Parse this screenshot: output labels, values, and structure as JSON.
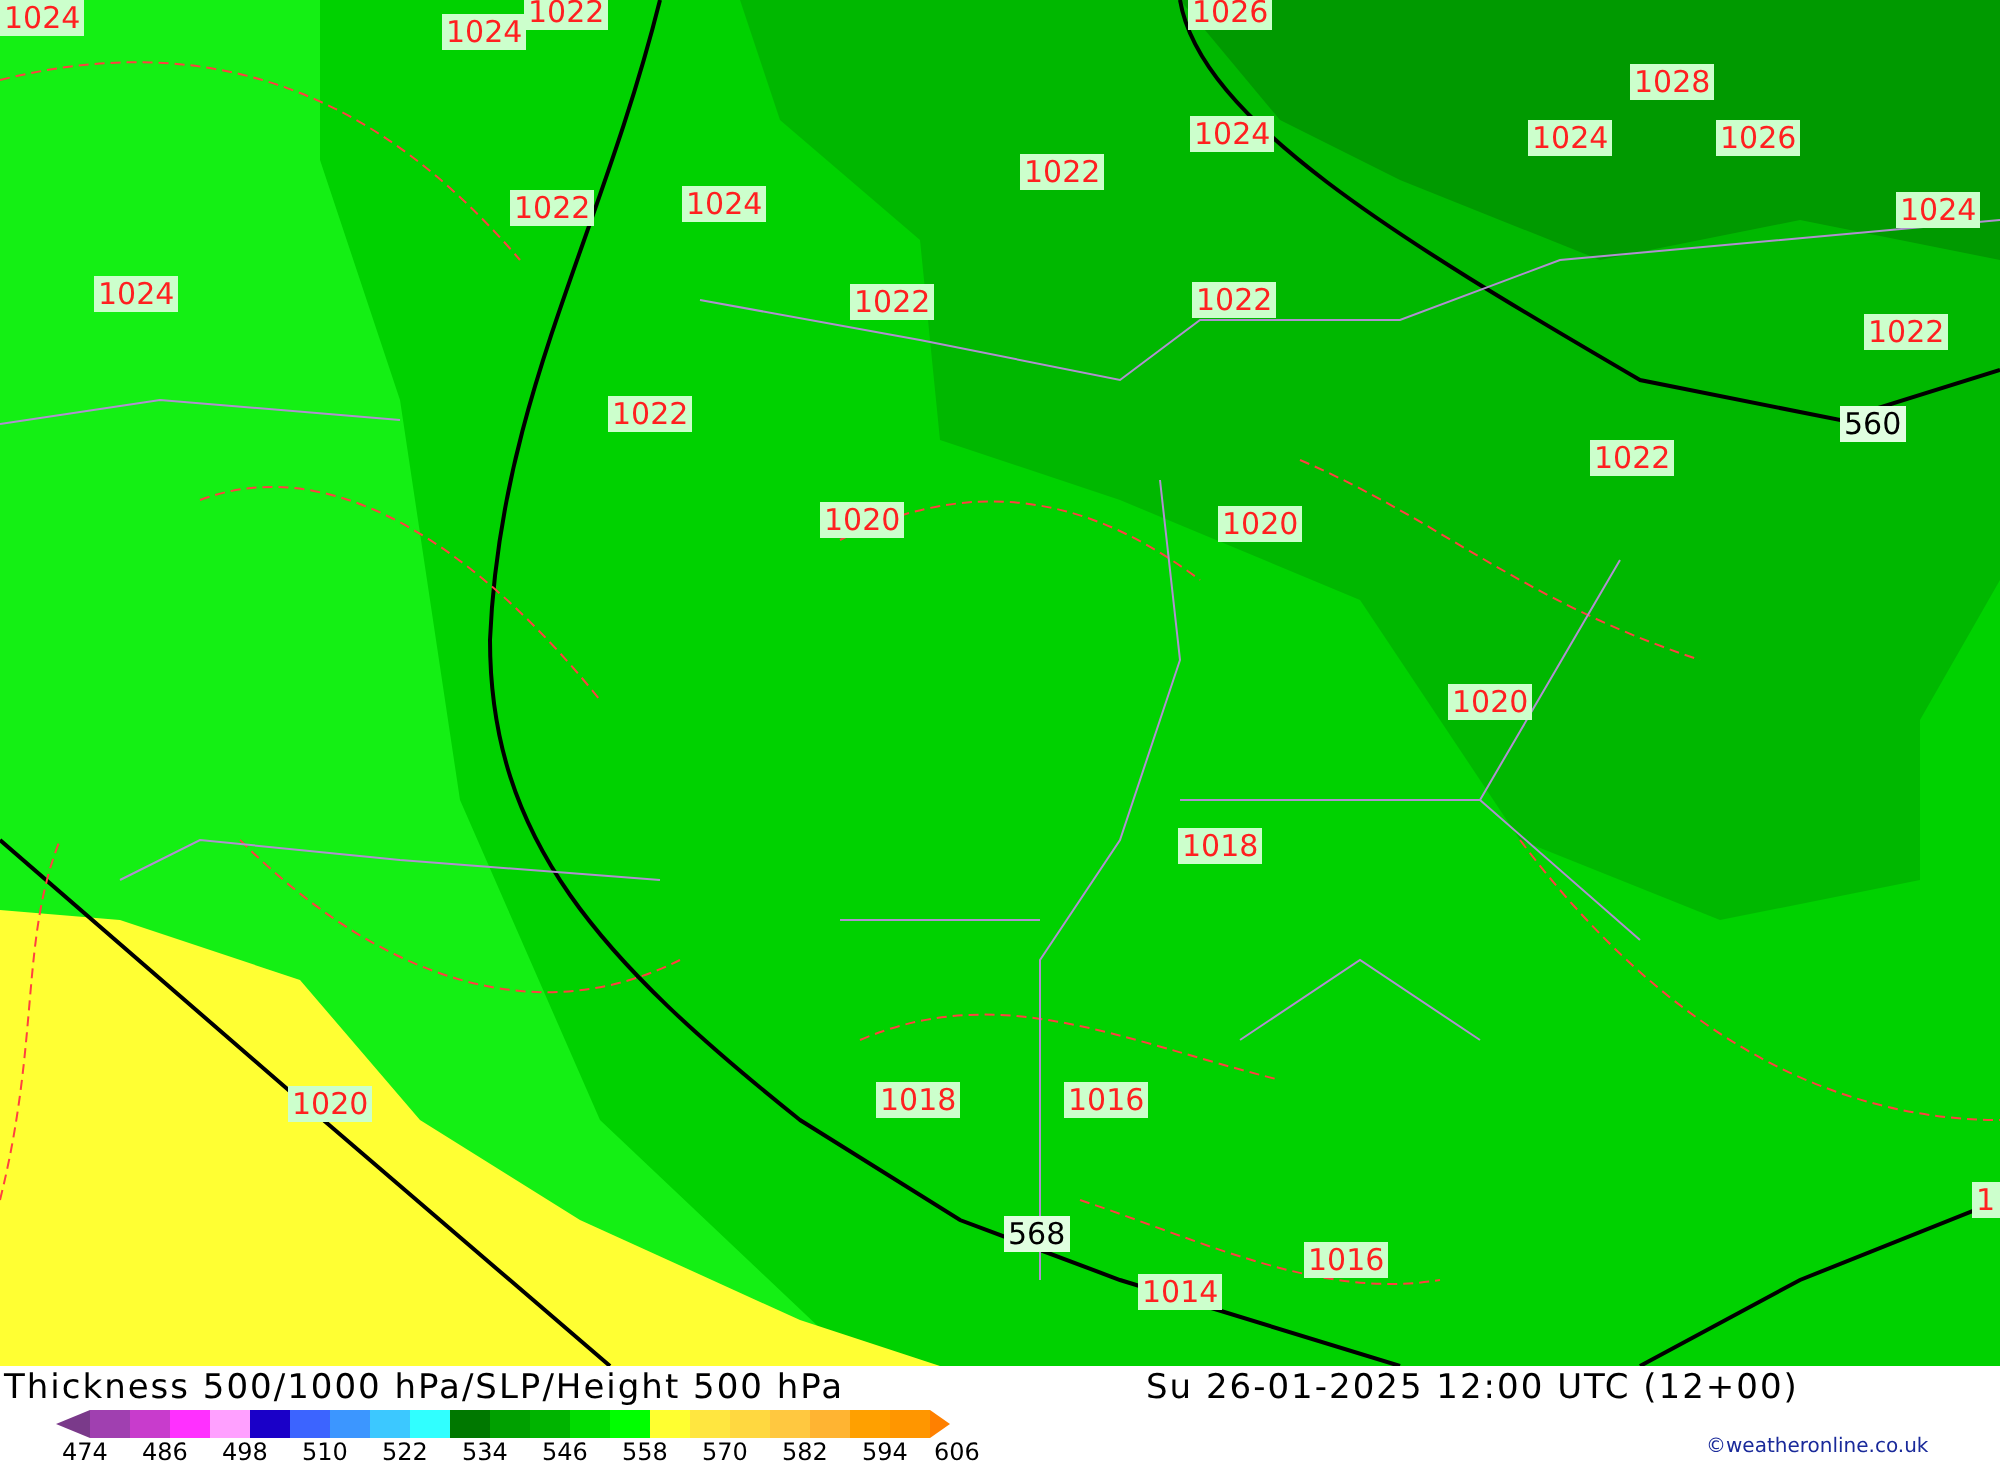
{
  "map": {
    "labels": [
      {
        "kind": "isobar",
        "text": "1024"
      },
      {
        "kind": "isobar",
        "text": "1024"
      },
      {
        "kind": "isobar",
        "text": "1022"
      },
      {
        "kind": "isobar",
        "text": "1026"
      },
      {
        "kind": "isobar",
        "text": "1028"
      },
      {
        "kind": "isobar",
        "text": "1024"
      },
      {
        "kind": "isobar",
        "text": "1024"
      },
      {
        "kind": "isobar",
        "text": "1026"
      },
      {
        "kind": "isobar",
        "text": "1022"
      },
      {
        "kind": "isobar",
        "text": "1024"
      },
      {
        "kind": "isobar",
        "text": "1022"
      },
      {
        "kind": "isobar",
        "text": "1024"
      },
      {
        "kind": "isobar",
        "text": "1024"
      },
      {
        "kind": "isobar",
        "text": "1022"
      },
      {
        "kind": "isobar",
        "text": "1022"
      },
      {
        "kind": "isobar",
        "text": "1022"
      },
      {
        "kind": "isobar",
        "text": "1022"
      },
      {
        "kind": "thickness",
        "text": "560"
      },
      {
        "kind": "isobar",
        "text": "1022"
      },
      {
        "kind": "isobar",
        "text": "1020"
      },
      {
        "kind": "isobar",
        "text": "1020"
      },
      {
        "kind": "isobar",
        "text": "1020"
      },
      {
        "kind": "isobar",
        "text": "1018"
      },
      {
        "kind": "isobar",
        "text": "1020"
      },
      {
        "kind": "isobar",
        "text": "1018"
      },
      {
        "kind": "isobar",
        "text": "1016"
      },
      {
        "kind": "isobar",
        "text": "1"
      },
      {
        "kind": "thickness",
        "text": "568"
      },
      {
        "kind": "isobar",
        "text": "1016"
      },
      {
        "kind": "isobar",
        "text": "1014"
      }
    ]
  },
  "footer": {
    "title": "Thickness 500/1000 hPa/SLP/Height 500 hPa",
    "datetime": "Su 26-01-2025 12:00 UTC (12+00)",
    "credit": "©weatheronline.co.uk",
    "legend": {
      "swatches": [
        {
          "kind": "start_arrow",
          "color": "#7a3a8a"
        },
        {
          "color": "#a040b0"
        },
        {
          "color": "#c83ccc"
        },
        {
          "color": "#ff30ff"
        },
        {
          "color": "#ffa0ff"
        },
        {
          "color": "#1a00c8"
        },
        {
          "color": "#3c64ff"
        },
        {
          "color": "#3c96ff"
        },
        {
          "color": "#3cc8ff"
        },
        {
          "color": "#30ffff"
        },
        {
          "color": "#007800"
        },
        {
          "color": "#00a000"
        },
        {
          "color": "#00b400"
        },
        {
          "color": "#00dc00"
        },
        {
          "color": "#00ff00"
        },
        {
          "color": "#ffff30"
        },
        {
          "color": "#ffe640"
        },
        {
          "color": "#ffd840"
        },
        {
          "color": "#ffc840"
        },
        {
          "color": "#ffb432"
        },
        {
          "color": "#ffa000"
        },
        {
          "color": "#ff9600"
        },
        {
          "kind": "end_arrow",
          "color": "#ff8000"
        }
      ],
      "ticks": [
        "474",
        "486",
        "498",
        "510",
        "522",
        "534",
        "546",
        "558",
        "570",
        "582",
        "594",
        "606"
      ]
    }
  }
}
